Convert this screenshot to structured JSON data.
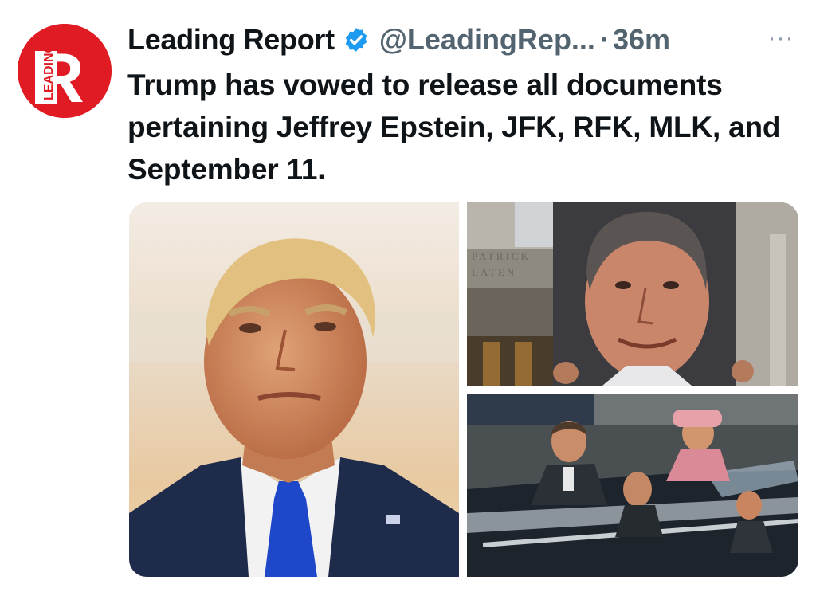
{
  "tweet": {
    "author_name": "Leading Report",
    "handle": "@LeadingRep...",
    "separator": "·",
    "time": "36m",
    "more_label": "···",
    "text": "Trump has vowed to release all documents pertaining Jeffrey Epstein, JFK, RFK, MLK, and September 11.",
    "avatar_letter": "R",
    "avatar_word": "LEADING",
    "brand_color": "#e01b24",
    "verified_color": "#1d9bf0"
  },
  "media": {
    "photo_count": 3,
    "building_inscription": "PATRICK\nLATEN"
  }
}
